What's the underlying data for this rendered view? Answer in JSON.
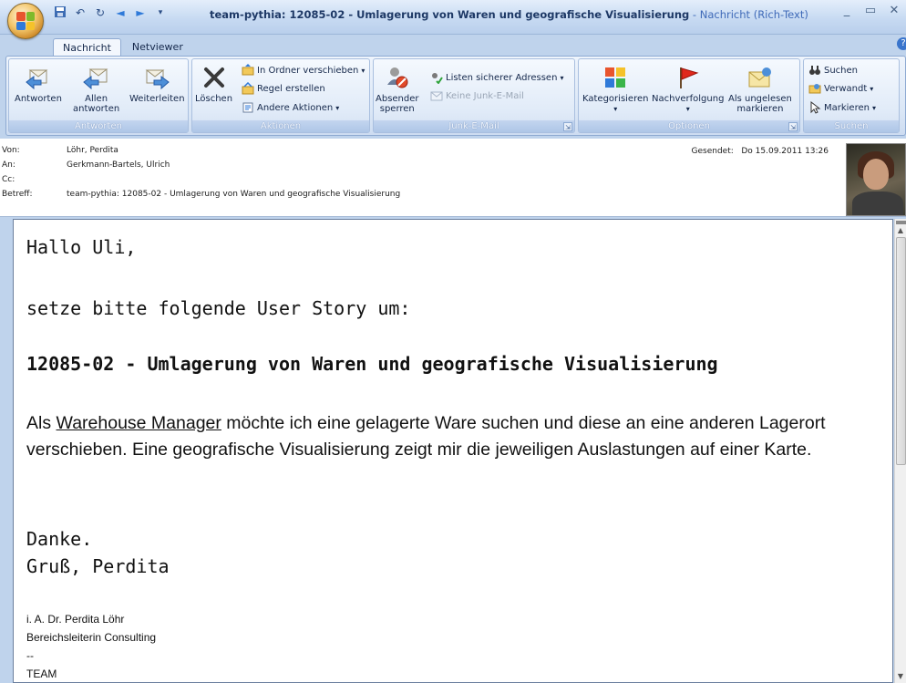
{
  "window": {
    "title_main": "team-pythia: 12085-02 - Umlagerung von Waren und geografische Visualisierung",
    "title_suffix": " - Nachricht (Rich-Text)",
    "minimize": "_",
    "maximize": "▭",
    "close": "✕"
  },
  "tabs": [
    "Nachricht",
    "Netviewer"
  ],
  "ribbon": {
    "antworten": {
      "label": "Antworten",
      "reply": "Antworten",
      "reply_all_1": "Allen",
      "reply_all_2": "antworten",
      "forward": "Weiterleiten"
    },
    "aktionen": {
      "label": "Aktionen",
      "delete": "Löschen",
      "move": "In Ordner verschieben",
      "rule": "Regel erstellen",
      "other": "Andere Aktionen"
    },
    "junk": {
      "label": "Junk-E-Mail",
      "block_1": "Absender",
      "block_2": "sperren",
      "safe_lists": "Listen sicherer Adressen",
      "not_junk": "Keine Junk-E-Mail"
    },
    "optionen": {
      "label": "Optionen",
      "categorize": "Kategorisieren",
      "followup": "Nachverfolgung",
      "unread_1": "Als ungelesen",
      "unread_2": "markieren"
    },
    "suchen": {
      "label": "Suchen",
      "find": "Suchen",
      "related": "Verwandt",
      "select": "Markieren"
    }
  },
  "header": {
    "from_label": "Von:",
    "from": "Löhr, Perdita",
    "to_label": "An:",
    "to": "Gerkmann-Bartels, Ulrich",
    "cc_label": "Cc:",
    "cc": "",
    "subject_label": "Betreff:",
    "subject": "team-pythia: 12085-02 - Umlagerung von Waren und geografische Visualisierung",
    "sent_label": "Gesendet:",
    "sent": "Do 15.09.2011 13:26"
  },
  "message": {
    "greeting": "Hallo Uli,",
    "request": "setze bitte folgende User Story um:",
    "story_title": "12085-02 - Umlagerung von Waren und geografische Visualisierung",
    "story_pre": "Als ",
    "story_link": "Warehouse Manager",
    "story_post": " möchte ich eine gelagerte Ware suchen und diese an eine anderen Lagerort verschieben. Eine geografische Visualisierung zeigt mir die jeweiligen Auslastungen auf einer Karte.",
    "thanks": "Danke.",
    "regards": "Gruß, Perdita",
    "sig_line1": "i. A. Dr. Perdita Löhr",
    "sig_line2": "Bereichsleiterin Consulting",
    "sig_line3": "--",
    "sig_line4": "TEAM"
  }
}
